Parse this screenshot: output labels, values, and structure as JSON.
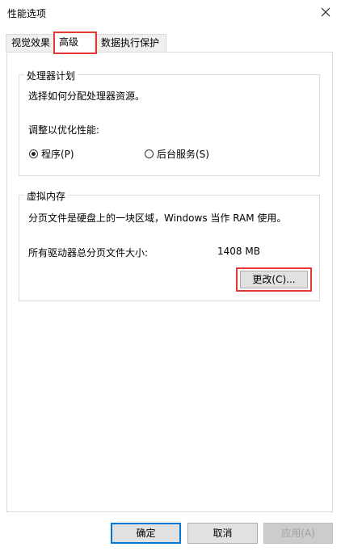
{
  "window": {
    "title": "性能选项",
    "close_icon": "close-icon"
  },
  "tabs": [
    {
      "label": "视觉效果",
      "active": false
    },
    {
      "label": "高级",
      "active": true
    },
    {
      "label": "数据执行保护",
      "active": false
    }
  ],
  "processor_group": {
    "legend": "处理器计划",
    "description": "选择如何分配处理器资源。",
    "adjust_label": "调整以优化性能:",
    "options": [
      {
        "label": "程序(P)",
        "checked": true
      },
      {
        "label": "后台服务(S)",
        "checked": false
      }
    ]
  },
  "virtual_memory_group": {
    "legend": "虚拟内存",
    "description": "分页文件是硬盘上的一块区域，Windows 当作 RAM 使用。",
    "total_label": "所有驱动器总分页文件大小:",
    "total_value": "1408 MB",
    "change_button": "更改(C)..."
  },
  "footer": {
    "ok_button": "确定",
    "cancel_button": "取消",
    "apply_button": "应用(A)"
  },
  "colors": {
    "highlight": "#e53935",
    "accent": "#0078d7"
  }
}
